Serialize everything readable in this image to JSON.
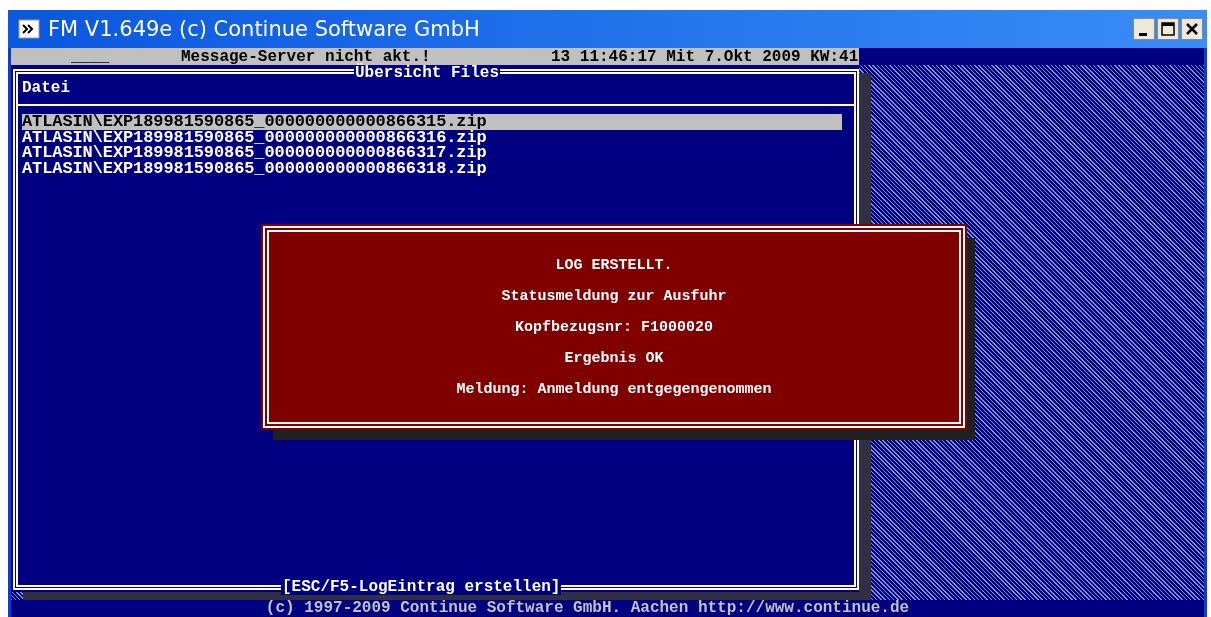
{
  "window": {
    "title": "FM V1.649e (c) Continue Software GmbH"
  },
  "status_line": {
    "field": "____",
    "message": "Message-Server nicht akt.!",
    "datetime": "13 11:46:17 Mit 7.Okt 2009 KW:41"
  },
  "panel": {
    "title": "Übersicht Files",
    "column": "Datei",
    "rows": [
      {
        "file": "ATLASIN\\EXP189981590865_000000000000866315.zip",
        "selected": true
      },
      {
        "file": "ATLASIN\\EXP189981590865_000000000000866316.zip",
        "selected": false
      },
      {
        "file": "ATLASIN\\EXP189981590865_000000000000866317.zip",
        "selected": false
      },
      {
        "file": "ATLASIN\\EXP189981590865_000000000000866318.zip",
        "selected": false
      }
    ],
    "hint": "[ESC/F5-LogEintrag erstellen]"
  },
  "dialog": {
    "lines": [
      "LOG ERSTELLT.",
      "Statusmeldung zur Ausfuhr",
      "Kopfbezugsnr: F1000020",
      "Ergebnis OK",
      "Meldung: Anmeldung entgegengenommen"
    ]
  },
  "footer": "(c) 1997-2009 Continue Software GmbH. Aachen http://www.continue.de"
}
